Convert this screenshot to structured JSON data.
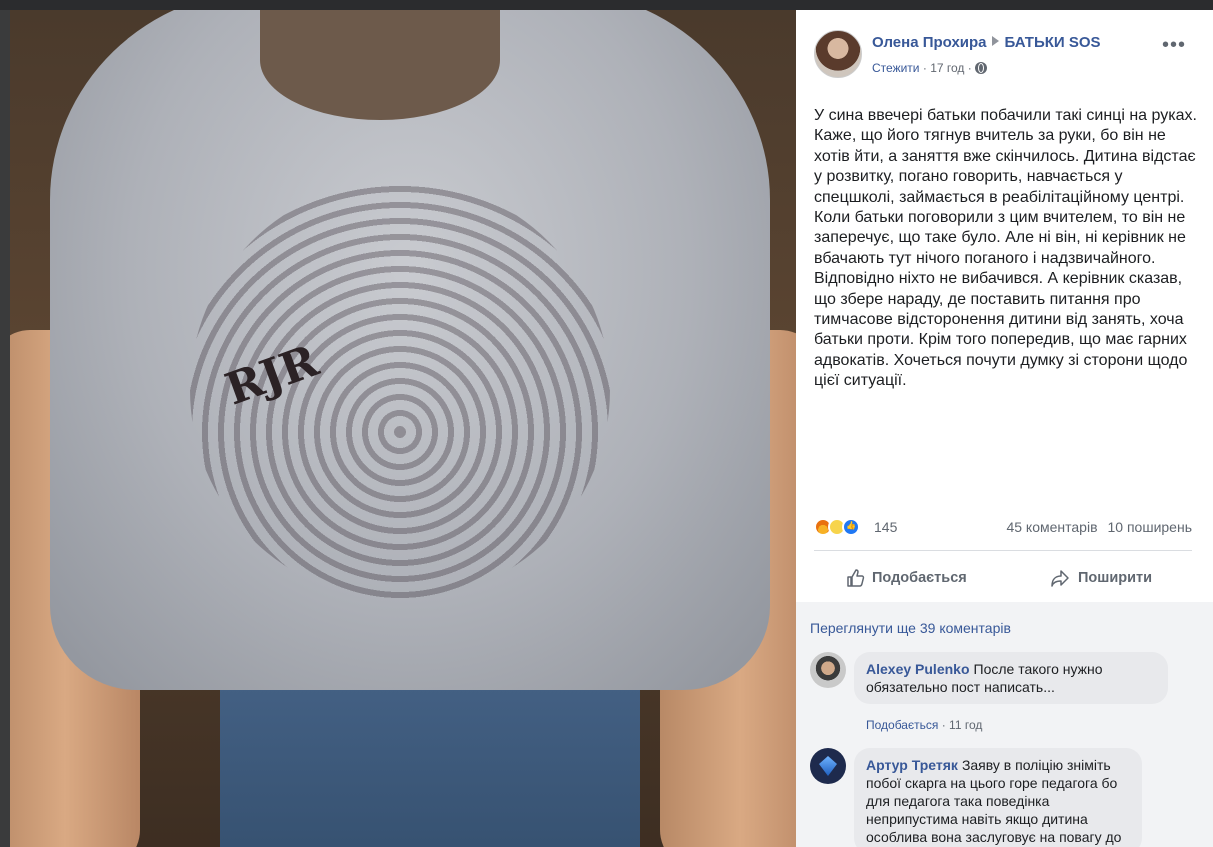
{
  "post": {
    "author": "Олена Прохира",
    "group": "БАТЬКИ SOS",
    "follow": "Стежити",
    "separator": "·",
    "time": "17 год",
    "text": "У сина ввечері батьки побачили такі синці на руках. Каже, що його тягнув вчитель за руки, бо він не хотів йти, а заняття вже скінчилось. Дитина відстає у розвитку, погано говорить, навчається у спецшколі, займається в реабілітаційному центрі. Коли батьки поговорили з цим вчителем, то він не заперечує, що таке було. Але ні він, ні керівник не вбачають тут нічого поганого і надзвичайного. Відповідно ніхто не вибачився. А керівник сказав, що збере нараду, де поставить питання про тимчасове відсторонення дитини від занять, хоча батьки проти. Крім того попередив, що має гарних адвокатів. Хочеться почути думку зі сторони щодо цієї ситуації.",
    "more_label": "•••"
  },
  "photo": {
    "shirt_print": "RJR"
  },
  "reactions": {
    "count": "145",
    "comments": "45 коментарів",
    "shares": "10 поширень"
  },
  "actions": {
    "like": "Подобається",
    "share": "Поширити"
  },
  "comments": {
    "view_more": "Переглянути ще 39 коментарів",
    "items": [
      {
        "author": "Alexey Pulenko",
        "text_line1": "После такого нужно",
        "text_line2": "обязательно пост написать...",
        "like": "Подобається",
        "time": "11 год"
      },
      {
        "author": "Артур Третяк",
        "text_line1": "Заяву в поліцію зніміть",
        "text_line2": "побої скарга на цього горе педагога бо",
        "text_line3": "для педагога така поведінка",
        "text_line4": "неприпустима навіть якщо дитина",
        "text_line5": "особлива вона заслуговує на повагу до"
      }
    ]
  }
}
